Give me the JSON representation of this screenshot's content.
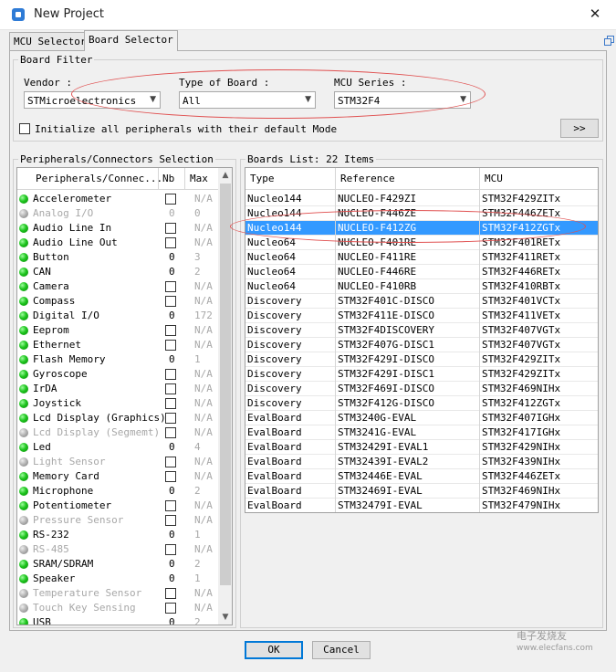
{
  "window": {
    "title": "New Project",
    "close_glyph": "✕"
  },
  "tabs": [
    {
      "label": "MCU Selector",
      "active": false
    },
    {
      "label": "Board Selector",
      "active": true
    }
  ],
  "board_filter": {
    "title": "Board Filter",
    "vendor": {
      "label": "Vendor :",
      "value": "STMicroelectronics"
    },
    "type_of_board": {
      "label": "Type of Board :",
      "value": "All"
    },
    "mcu_series": {
      "label": "MCU Series :",
      "value": "STM32F4"
    },
    "init_peripherals": {
      "label": "Initialize all peripherals with their default Mode",
      "checked": false
    },
    "expand_button": ">>"
  },
  "peripherals": {
    "title": "Peripherals/Connectors Selection",
    "columns": {
      "name": "Peripherals/Connec...",
      "nb": "Nb",
      "max": "Max"
    },
    "rows": [
      {
        "name": "Accelerometer",
        "enabled": true,
        "nb": "",
        "max": "N/A"
      },
      {
        "name": "Analog I/O",
        "enabled": false,
        "nb": "0",
        "max": "0"
      },
      {
        "name": "Audio Line In",
        "enabled": true,
        "nb": "",
        "max": "N/A"
      },
      {
        "name": "Audio Line Out",
        "enabled": true,
        "nb": "",
        "max": "N/A"
      },
      {
        "name": "Button",
        "enabled": true,
        "nb": "0",
        "max": "3"
      },
      {
        "name": "CAN",
        "enabled": true,
        "nb": "0",
        "max": "2"
      },
      {
        "name": "Camera",
        "enabled": true,
        "nb": "",
        "max": "N/A"
      },
      {
        "name": "Compass",
        "enabled": true,
        "nb": "",
        "max": "N/A"
      },
      {
        "name": "Digital I/O",
        "enabled": true,
        "nb": "0",
        "max": "172"
      },
      {
        "name": "Eeprom",
        "enabled": true,
        "nb": "",
        "max": "N/A"
      },
      {
        "name": "Ethernet",
        "enabled": true,
        "nb": "",
        "max": "N/A"
      },
      {
        "name": "Flash Memory",
        "enabled": true,
        "nb": "0",
        "max": "1"
      },
      {
        "name": "Gyroscope",
        "enabled": true,
        "nb": "",
        "max": "N/A"
      },
      {
        "name": "IrDA",
        "enabled": true,
        "nb": "",
        "max": "N/A"
      },
      {
        "name": "Joystick",
        "enabled": true,
        "nb": "",
        "max": "N/A"
      },
      {
        "name": "Lcd Display (Graphics)",
        "enabled": true,
        "nb": "",
        "max": "N/A"
      },
      {
        "name": "Lcd Display (Segmemt)",
        "enabled": false,
        "nb": "",
        "max": "N/A"
      },
      {
        "name": "Led",
        "enabled": true,
        "nb": "0",
        "max": "4"
      },
      {
        "name": "Light Sensor",
        "enabled": false,
        "nb": "",
        "max": "N/A"
      },
      {
        "name": "Memory Card",
        "enabled": true,
        "nb": "",
        "max": "N/A"
      },
      {
        "name": "Microphone",
        "enabled": true,
        "nb": "0",
        "max": "2"
      },
      {
        "name": "Potentiometer",
        "enabled": true,
        "nb": "",
        "max": "N/A"
      },
      {
        "name": "Pressure Sensor",
        "enabled": false,
        "nb": "",
        "max": "N/A"
      },
      {
        "name": "RS-232",
        "enabled": true,
        "nb": "0",
        "max": "1"
      },
      {
        "name": "RS-485",
        "enabled": false,
        "nb": "",
        "max": "N/A"
      },
      {
        "name": "SRAM/SDRAM",
        "enabled": true,
        "nb": "0",
        "max": "2"
      },
      {
        "name": "Speaker",
        "enabled": true,
        "nb": "0",
        "max": "1"
      },
      {
        "name": "Temperature Sensor",
        "enabled": false,
        "nb": "",
        "max": "N/A"
      },
      {
        "name": "Touch Key Sensing",
        "enabled": false,
        "nb": "",
        "max": "N/A"
      },
      {
        "name": "USB",
        "enabled": true,
        "nb": "0",
        "max": "2"
      }
    ]
  },
  "boards": {
    "title": "Boards List: 22 Items",
    "columns": {
      "type": "Type",
      "reference": "Reference",
      "mcu": "MCU"
    },
    "rows": [
      {
        "type": "Nucleo144",
        "reference": "NUCLEO-F429ZI",
        "mcu": "STM32F429ZITx",
        "selected": false
      },
      {
        "type": "Nucleo144",
        "reference": "NUCLEO-F446ZE",
        "mcu": "STM32F446ZETx",
        "selected": false
      },
      {
        "type": "Nucleo144",
        "reference": "NUCLEO-F412ZG",
        "mcu": "STM32F412ZGTx",
        "selected": true
      },
      {
        "type": "Nucleo64",
        "reference": "NUCLEO-F401RE",
        "mcu": "STM32F401RETx",
        "selected": false
      },
      {
        "type": "Nucleo64",
        "reference": "NUCLEO-F411RE",
        "mcu": "STM32F411RETx",
        "selected": false
      },
      {
        "type": "Nucleo64",
        "reference": "NUCLEO-F446RE",
        "mcu": "STM32F446RETx",
        "selected": false
      },
      {
        "type": "Nucleo64",
        "reference": "NUCLEO-F410RB",
        "mcu": "STM32F410RBTx",
        "selected": false
      },
      {
        "type": "Discovery",
        "reference": "STM32F401C-DISCO",
        "mcu": "STM32F401VCTx",
        "selected": false
      },
      {
        "type": "Discovery",
        "reference": "STM32F411E-DISCO",
        "mcu": "STM32F411VETx",
        "selected": false
      },
      {
        "type": "Discovery",
        "reference": "STM32F4DISCOVERY",
        "mcu": "STM32F407VGTx",
        "selected": false
      },
      {
        "type": "Discovery",
        "reference": "STM32F407G-DISC1",
        "mcu": "STM32F407VGTx",
        "selected": false
      },
      {
        "type": "Discovery",
        "reference": "STM32F429I-DISCO",
        "mcu": "STM32F429ZITx",
        "selected": false
      },
      {
        "type": "Discovery",
        "reference": "STM32F429I-DISC1",
        "mcu": "STM32F429ZITx",
        "selected": false
      },
      {
        "type": "Discovery",
        "reference": "STM32F469I-DISCO",
        "mcu": "STM32F469NIHx",
        "selected": false
      },
      {
        "type": "Discovery",
        "reference": "STM32F412G-DISCO",
        "mcu": "STM32F412ZGTx",
        "selected": false
      },
      {
        "type": "EvalBoard",
        "reference": "STM3240G-EVAL",
        "mcu": "STM32F407IGHx",
        "selected": false
      },
      {
        "type": "EvalBoard",
        "reference": "STM3241G-EVAL",
        "mcu": "STM32F417IGHx",
        "selected": false
      },
      {
        "type": "EvalBoard",
        "reference": "STM32429I-EVAL1",
        "mcu": "STM32F429NIHx",
        "selected": false
      },
      {
        "type": "EvalBoard",
        "reference": "STM32439I-EVAL2",
        "mcu": "STM32F439NIHx",
        "selected": false
      },
      {
        "type": "EvalBoard",
        "reference": "STM32446E-EVAL",
        "mcu": "STM32F446ZETx",
        "selected": false
      },
      {
        "type": "EvalBoard",
        "reference": "STM32469I-EVAL",
        "mcu": "STM32F469NIHx",
        "selected": false
      },
      {
        "type": "EvalBoard",
        "reference": "STM32479I-EVAL",
        "mcu": "STM32F479NIHx",
        "selected": false
      }
    ]
  },
  "footer": {
    "ok_label": "OK",
    "cancel_label": "Cancel"
  },
  "watermark": {
    "brand": "电子发烧友",
    "url": "www.elecfans.com"
  },
  "colors": {
    "selection": "#3399ff",
    "annotation": "#e05050",
    "led_on": "#1ec41e"
  }
}
